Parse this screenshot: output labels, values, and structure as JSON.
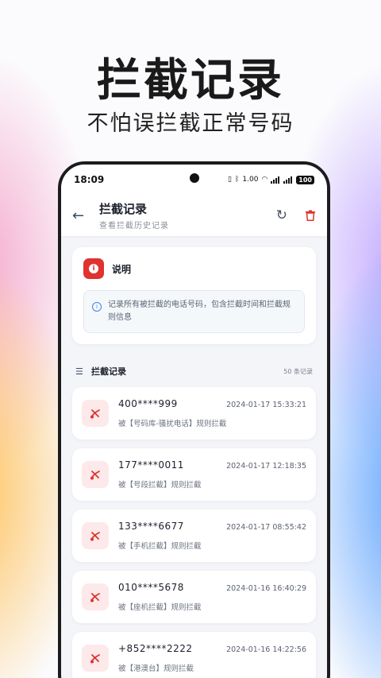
{
  "hero": {
    "title": "拦截记录",
    "subtitle": "不怕误拦截正常号码"
  },
  "statusbar": {
    "time": "18:09",
    "network_speed": "1.00",
    "battery": "100"
  },
  "appbar": {
    "title": "拦截记录",
    "subtitle": "查看拦截历史记录"
  },
  "info": {
    "title": "说明",
    "text": "记录所有被拦截的电话号码，包含拦截时间和拦截规则信息"
  },
  "section": {
    "title": "拦截记录",
    "count": "50 条记录"
  },
  "records": [
    {
      "number": "400****999",
      "time": "2024-01-17 15:33:21",
      "rule": "被【号码库-骚扰电话】规则拦截"
    },
    {
      "number": "177****0011",
      "time": "2024-01-17 12:18:35",
      "rule": "被【号段拦截】规则拦截"
    },
    {
      "number": "133****6677",
      "time": "2024-01-17 08:55:42",
      "rule": "被【手机拦截】规则拦截"
    },
    {
      "number": "010****5678",
      "time": "2024-01-16 16:40:29",
      "rule": "被【座机拦截】规则拦截"
    },
    {
      "number": "+852****2222",
      "time": "2024-01-16 14:22:56",
      "rule": "被【港澳台】规则拦截"
    }
  ],
  "colors": {
    "accent_red": "#e0322f",
    "info_blue": "#3b82f6"
  },
  "icons": {
    "back": "arrow-left-icon",
    "refresh": "refresh-icon",
    "delete": "trash-icon",
    "info": "info-icon",
    "list": "list-icon",
    "blocked_call": "phone-missed-icon"
  }
}
